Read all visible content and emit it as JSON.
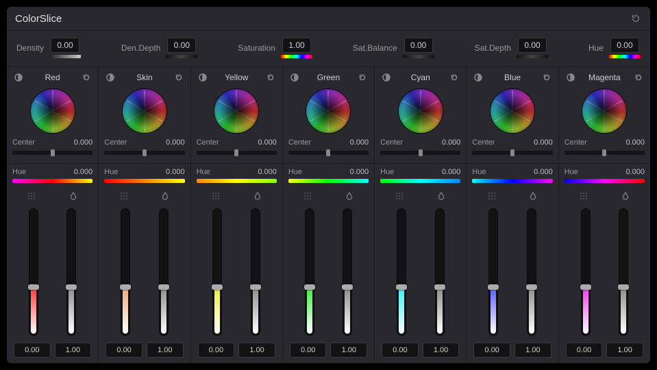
{
  "title": "ColorSlice",
  "globals": [
    {
      "label": "Density",
      "value": "0.00",
      "gradient": "gray"
    },
    {
      "label": "Den.Depth",
      "value": "0.00",
      "gradient": "dark"
    },
    {
      "label": "Saturation",
      "value": "1.00",
      "gradient": "rainbow"
    },
    {
      "label": "Sat.Balance",
      "value": "0.00",
      "gradient": "dark"
    },
    {
      "label": "Sat.Depth",
      "value": "0.00",
      "gradient": "dark"
    },
    {
      "label": "Hue",
      "value": "0.00",
      "gradient": "rainbow"
    }
  ],
  "center_label": "Center",
  "hue_label": "Hue",
  "columns": [
    {
      "name": "Red",
      "center": "0.000",
      "hue": "0.000",
      "density": "0.00",
      "sat": "1.00",
      "hueClass": "hue-red",
      "fillClass": "fill-red"
    },
    {
      "name": "Skin",
      "center": "0.000",
      "hue": "0.000",
      "density": "0.00",
      "sat": "1.00",
      "hueClass": "hue-skin",
      "fillClass": "fill-skin"
    },
    {
      "name": "Yellow",
      "center": "0.000",
      "hue": "0.000",
      "density": "0.00",
      "sat": "1.00",
      "hueClass": "hue-yellow",
      "fillClass": "fill-yellow"
    },
    {
      "name": "Green",
      "center": "0.000",
      "hue": "0.000",
      "density": "0.00",
      "sat": "1.00",
      "hueClass": "hue-green",
      "fillClass": "fill-green"
    },
    {
      "name": "Cyan",
      "center": "0.000",
      "hue": "0.000",
      "density": "0.00",
      "sat": "1.00",
      "hueClass": "hue-cyan",
      "fillClass": "fill-cyan"
    },
    {
      "name": "Blue",
      "center": "0.000",
      "hue": "0.000",
      "density": "0.00",
      "sat": "1.00",
      "hueClass": "hue-blue",
      "fillClass": "fill-blue"
    },
    {
      "name": "Magenta",
      "center": "0.000",
      "hue": "0.000",
      "density": "0.00",
      "sat": "1.00",
      "hueClass": "hue-magenta",
      "fillClass": "fill-magenta"
    }
  ]
}
